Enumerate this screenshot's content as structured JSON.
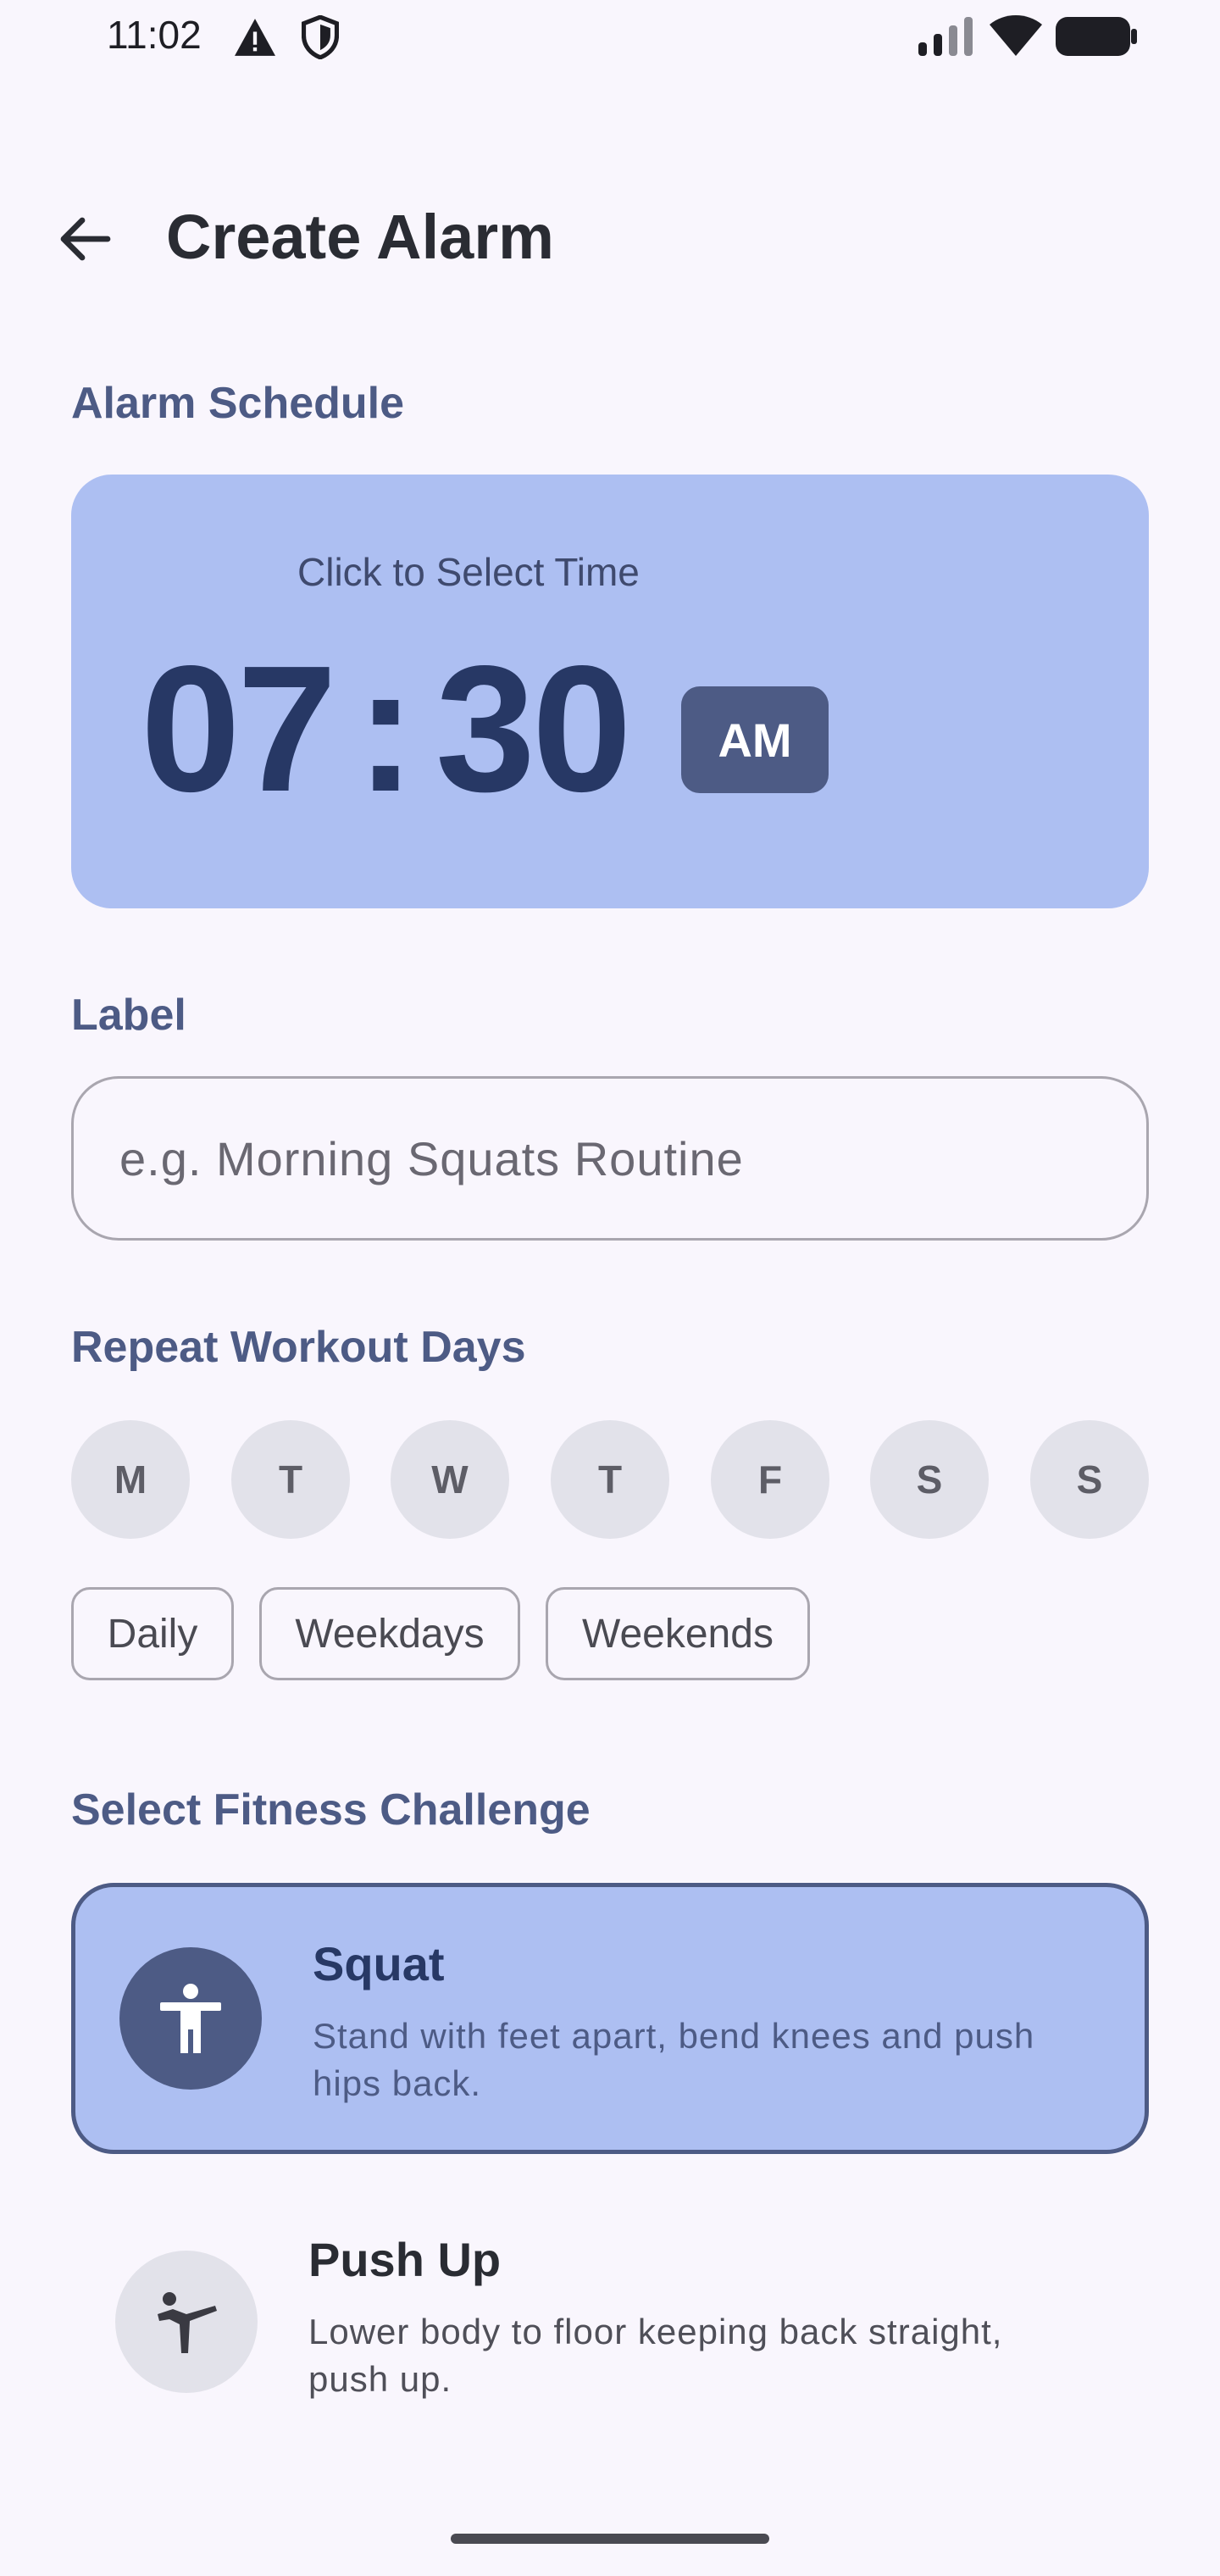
{
  "status_bar": {
    "time": "11:02",
    "icons": [
      "warning-icon",
      "shield-icon",
      "signal-icon",
      "wifi-icon",
      "battery-icon"
    ]
  },
  "header": {
    "back_icon": "arrow-left-icon",
    "title": "Create Alarm"
  },
  "schedule": {
    "section_title": "Alarm Schedule",
    "hint": "Click to Select Time",
    "hours": "07",
    "separator": ":",
    "minutes": "30",
    "period": "AM"
  },
  "label": {
    "section_title": "Label",
    "value": "",
    "placeholder": "e.g. Morning Squats Routine"
  },
  "repeat": {
    "section_title": "Repeat Workout Days",
    "days": [
      "M",
      "T",
      "W",
      "T",
      "F",
      "S",
      "S"
    ],
    "presets": [
      "Daily",
      "Weekdays",
      "Weekends"
    ]
  },
  "challenge": {
    "section_title": "Select Fitness Challenge",
    "options": [
      {
        "name": "Squat",
        "description": "Stand with feet apart, bend knees and push hips back.",
        "icon": "accessibility-person-icon",
        "selected": true
      },
      {
        "name": "Push Up",
        "description": "Lower body to floor keeping back straight, push up.",
        "icon": "martial-arts-kick-icon",
        "selected": false
      }
    ]
  },
  "colors": {
    "background": "#f9f6fd",
    "accent_light": "#adbff2",
    "accent_dark": "#4d5b85",
    "time_text": "#273865",
    "chip_bg": "#e2e2ea"
  }
}
